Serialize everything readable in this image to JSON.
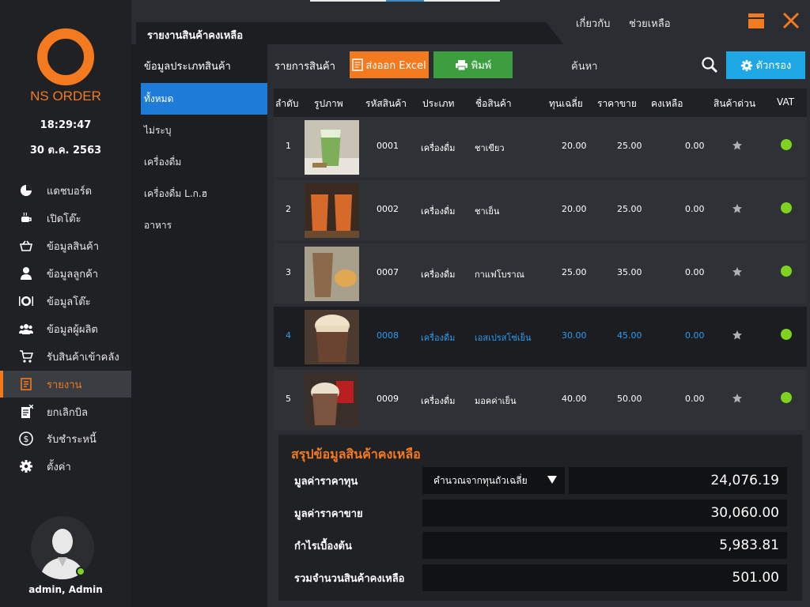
{
  "sidebar": {
    "logo_text": "NS ORDER",
    "time": "18:29:47",
    "date": "30 ต.ค. 2563",
    "items": [
      {
        "label": "แดชบอร์ด",
        "icon": "pie-chart-icon"
      },
      {
        "label": "เปิดโต๊ะ",
        "icon": "coffee-icon"
      },
      {
        "label": "ข้อมูลสินค้า",
        "icon": "basket-icon"
      },
      {
        "label": "ข้อมูลลูกค้า",
        "icon": "user-icon"
      },
      {
        "label": "ข้อมูลโต๊ะ",
        "icon": "plate-icon"
      },
      {
        "label": "ข้อมูลผู้ผลิต",
        "icon": "users-icon"
      },
      {
        "label": "รับสินค้าเข้าคลัง",
        "icon": "cart-icon"
      },
      {
        "label": "รายงาน",
        "icon": "report-icon"
      },
      {
        "label": "ยกเลิกบิล",
        "icon": "cancel-bill-icon"
      },
      {
        "label": "รับชำระหนี้",
        "icon": "dollar-icon"
      },
      {
        "label": "ตั้งค่า",
        "icon": "gear-icon"
      }
    ],
    "active_index": 7,
    "user": "admin, Admin",
    "accent": "#f47a20"
  },
  "header": {
    "title": "รายงานสินค้าคงเหลือ",
    "about": "เกี่ยวกับ",
    "help": "ช่วยเหลือ"
  },
  "categories": {
    "header": "ข้อมูลประเภทสินค้า",
    "items": [
      "ทั้งหมด",
      "ไม่ระบุ",
      "เครื่องดื่ม",
      "เครื่องดื่ม L.ก.ฮ",
      "อาหาร"
    ],
    "active_index": 0
  },
  "toolbar": {
    "list_label": "รายการสินค้า",
    "excel": "ส่งออก Excel",
    "print": "พิมพ์",
    "search_placeholder": "ค้นหา",
    "filter": "ตัวกรอง"
  },
  "table": {
    "columns": [
      "ลำดับ",
      "รูปภาพ",
      "รหัสสินค้า",
      "ประเภท",
      "ชื่อสินค้า",
      "ทุนเฉลี่ย",
      "ราคาขาย",
      "คงเหลือ",
      "สินค้าด่วน",
      "VAT"
    ],
    "rows": [
      {
        "no": "1",
        "code": "0001",
        "type": "เครื่องดื่ม",
        "name": "ชาเขียว",
        "cost": "20.00",
        "price": "25.00",
        "stock": "0.00",
        "vat": true
      },
      {
        "no": "2",
        "code": "0002",
        "type": "เครื่องดื่ม",
        "name": "ชาเย็น",
        "cost": "20.00",
        "price": "25.00",
        "stock": "0.00",
        "vat": true
      },
      {
        "no": "3",
        "code": "0007",
        "type": "เครื่องดื่ม",
        "name": "กาแฟโบราณ",
        "cost": "25.00",
        "price": "35.00",
        "stock": "0.00",
        "vat": true
      },
      {
        "no": "4",
        "code": "0008",
        "type": "เครื่องดื่ม",
        "name": "เอสเปรสโซ่เย็น",
        "cost": "30.00",
        "price": "45.00",
        "stock": "0.00",
        "vat": true
      },
      {
        "no": "5",
        "code": "0009",
        "type": "เครื่องดื่ม",
        "name": "มอคค่าเย็น",
        "cost": "40.00",
        "price": "50.00",
        "stock": "0.00",
        "vat": true
      }
    ],
    "selected_index": 3
  },
  "summary": {
    "title": "สรุปข้อมูลสินค้าคงเหลือ",
    "cost_label": "มูลค่าราคาทุน",
    "cost_method": "คำนวณจากทุนถัวเฉลี่ย",
    "cost_value": "24,076.19",
    "sale_label": "มูลค่าราคาขาย",
    "sale_value": "30,060.00",
    "profit_label": "กำไรเบื้องต้น",
    "profit_value": "5,983.81",
    "qty_label": "รวมจำนวนสินค้าคงเหลือ",
    "qty_value": "501.00"
  }
}
